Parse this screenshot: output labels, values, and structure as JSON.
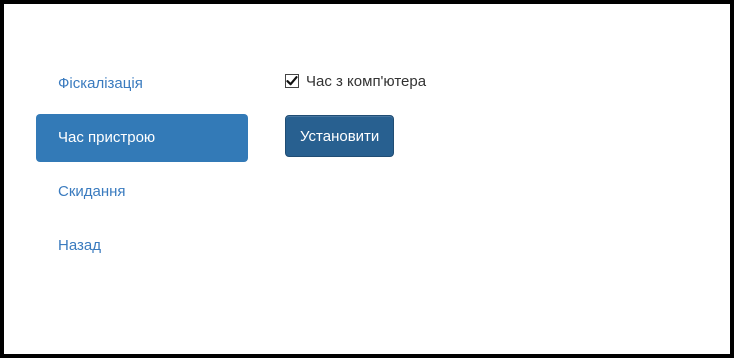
{
  "sidebar": {
    "items": [
      {
        "label": "Фіскалізація",
        "active": false
      },
      {
        "label": "Час пристрою",
        "active": true
      },
      {
        "label": "Скидання",
        "active": false
      },
      {
        "label": "Назад",
        "active": false
      }
    ]
  },
  "main": {
    "checkbox": {
      "label": "Час з комп'ютера",
      "checked": true
    },
    "set_button_label": "Установити"
  },
  "colors": {
    "accent": "#337ab7",
    "link": "#3a7bbf",
    "button": "#286090"
  }
}
